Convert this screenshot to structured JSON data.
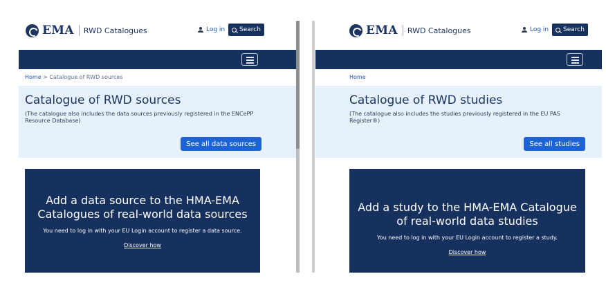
{
  "left": {
    "logo_text": "EMA",
    "logo_sub": "RWD Catalogues",
    "login_label": "Log in",
    "search_label": "Search",
    "breadcrumb_home": "Home",
    "breadcrumb_sep": ">",
    "breadcrumb_current": "Catalogue of RWD sources",
    "hero_title": "Catalogue of RWD sources",
    "hero_desc": "(The catalogue also includes the data sources previously registered in the ENCePP Resource Database)",
    "hero_button": "See all data sources",
    "cta_title": "Add a data source to the HMA-EMA Catalogues of real-world data sources",
    "cta_text": "You need to log in with your EU Login account to register a data source.",
    "cta_link": "Discover how"
  },
  "right": {
    "logo_text": "EMA",
    "logo_sub": "RWD Catalogues",
    "login_label": "Log in",
    "search_label": "Search",
    "breadcrumb_home": "Home",
    "hero_title": "Catalogue of RWD studies",
    "hero_desc": "(The catalogue also includes the studies previously registered in the EU PAS Register®)",
    "hero_button": "See all studies",
    "cta_title": "Add a study to the HMA-EMA Catalogue of real-world data studies",
    "cta_text": "You need to log in with your EU Login account to register a study.",
    "cta_link": "Discover how"
  },
  "colors": {
    "brand_navy": "#16315e",
    "hero_bg": "#e7f1fc",
    "button_blue": "#1e63d6",
    "link_blue": "#1c56b8"
  },
  "icons": [
    "ema-logo-icon",
    "user-icon",
    "search-icon",
    "hamburger-menu-icon"
  ]
}
